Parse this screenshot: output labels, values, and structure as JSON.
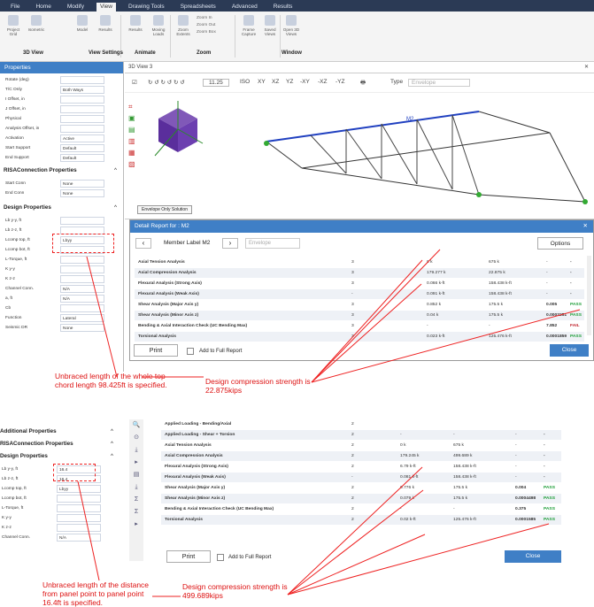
{
  "ribbon": {
    "tabs": [
      "File",
      "Home",
      "Modify",
      "View",
      "Drawing Tools",
      "Spreadsheets",
      "Advanced",
      "Results"
    ],
    "buttons": [
      "Project Grid",
      "Isometric",
      "Model",
      "Results",
      "Results",
      "Moving Loads",
      "Zoom Extents",
      "Zoom In",
      "Zoom Out",
      "Zoom Box",
      "Frame Capture",
      "Saved Views",
      "Open 3D Views"
    ],
    "groups": [
      "3D View",
      "View Settings",
      "Animate",
      "Zoom",
      "Window"
    ]
  },
  "props": {
    "title": "Properties",
    "top_rows": [
      {
        "label": "Rotate (deg)",
        "value": ""
      },
      {
        "label": "T/C Only",
        "value": "Both Ways"
      },
      {
        "label": "I Offset, in",
        "value": ""
      },
      {
        "label": "J Offset, in",
        "value": ""
      },
      {
        "label": "Physical",
        "value": ""
      },
      {
        "label": "Analysis Offset, in",
        "value": ""
      },
      {
        "label": "Activation",
        "value": "Active"
      },
      {
        "label": "Start Support",
        "value": "Default"
      },
      {
        "label": "End Support",
        "value": "Default"
      }
    ],
    "risa_title": "RISAConnection Properties",
    "risa_rows": [
      {
        "label": "Start Conn",
        "value": "None"
      },
      {
        "label": "End Conn",
        "value": "None"
      }
    ],
    "design_title": "Design Properties",
    "design_rows": [
      {
        "label": "Lb y-y, ft",
        "value": ""
      },
      {
        "label": "Lb z-z, ft",
        "value": ""
      },
      {
        "label": "Lcomp top, ft",
        "value": "Lbyy"
      },
      {
        "label": "Lcomp bot, ft",
        "value": ""
      },
      {
        "label": "L-Torque, ft",
        "value": ""
      },
      {
        "label": "K y-y",
        "value": ""
      },
      {
        "label": "K z-z",
        "value": ""
      },
      {
        "label": "Channel Conn.",
        "value": "N/A"
      },
      {
        "label": "a, ft",
        "value": "N/A"
      },
      {
        "label": "Cb",
        "value": ""
      },
      {
        "label": "Function",
        "value": "Lateral"
      },
      {
        "label": "Seismic DR",
        "value": "None"
      }
    ]
  },
  "view": {
    "title": "3D View 3",
    "toolbar": [
      "11.25",
      "ISO",
      "XY",
      "XZ",
      "YZ",
      "-XY",
      "-XZ",
      "-YZ",
      "Type",
      "Envelope"
    ],
    "envelope_label": "Envelope Only Solution",
    "m2_label": "M2"
  },
  "report": {
    "title": "Detail Report for : M2",
    "member_label": "Member Label M2",
    "dropdown": "Envelope",
    "options": "Options",
    "rows": [
      {
        "name": "Axial Tension Analysis",
        "lc": "3",
        "v1": "0 k",
        "v2": "675 k",
        "uc": "-",
        "s": "-"
      },
      {
        "name": "Axial Compression Analysis",
        "lc": "3",
        "v1": "179.277 k",
        "v2": "22.875 k",
        "uc": "-",
        "s": "-"
      },
      {
        "name": "Flexural Analysis (Strong Axis)",
        "lc": "3",
        "v1": "0.066 k-ft",
        "v2": "158.438 k-ft",
        "uc": "-",
        "s": "-"
      },
      {
        "name": "Flexural Analysis (Weak Axis)",
        "lc": "-",
        "v1": "0.091 k-ft",
        "v2": "158.438 k-ft",
        "uc": "-",
        "s": "-"
      },
      {
        "name": "Shear Analysis (Major Axis y)",
        "lc": "3",
        "v1": "0.852 k",
        "v2": "175.5 k",
        "uc": "0.005",
        "s": "PASS"
      },
      {
        "name": "Shear Analysis (Minor Axis z)",
        "lc": "3",
        "v1": "0.04 k",
        "v2": "175.5 k",
        "uc": "0.0002251",
        "s": "PASS"
      },
      {
        "name": "Bending & Axial Interaction Check (UC Bending Max)",
        "lc": "3",
        "v1": "-",
        "v2": "-",
        "uc": "7.852",
        "s": "FAIL"
      },
      {
        "name": "Torsional Analysis",
        "lc": "3",
        "v1": "0.023 k-ft",
        "v2": "125.476 k-ft",
        "uc": "0.0001859",
        "s": "PASS"
      }
    ],
    "print": "Print",
    "add": "Add to Full Report",
    "close": "Close"
  },
  "annotations": {
    "a1": "Unbraced length of the whole top chord length 98.425ft is specified.",
    "a2": "Design compression strength is 22.875kips",
    "a3": "Unbraced length of the distance from panel point to panel point 16.4ft is specified.",
    "a4": "Design compression strength is 499.689kips"
  },
  "bottom": {
    "props": [
      {
        "label": "Additional Properties",
        "kind": "sec"
      },
      {
        "label": "RISAConnection Properties",
        "kind": "sec"
      },
      {
        "label": "Design Properties",
        "kind": "sec"
      },
      {
        "label": "Lb y-y, ft",
        "value": "16.4"
      },
      {
        "label": "Lb z-z, ft",
        "value": "16.4"
      },
      {
        "label": "Lcomp top, ft",
        "value": "Lbyy"
      },
      {
        "label": "Lcomp bot, ft",
        "value": ""
      },
      {
        "label": "L-Torque, ft",
        "value": ""
      },
      {
        "label": "K y-y",
        "value": ""
      },
      {
        "label": "K z-z",
        "value": ""
      },
      {
        "label": "Channel Conn.",
        "value": "N/A"
      }
    ],
    "rows": [
      {
        "name": "Applied Loading - Bending/Axial",
        "lc": "2",
        "v1": "",
        "v2": "",
        "uc": "",
        "s": ""
      },
      {
        "name": "Applied Loading - Shear + Torsion",
        "lc": "2",
        "v1": "-",
        "v2": "-",
        "uc": "-",
        "s": "-"
      },
      {
        "name": "Axial Tension Analysis",
        "lc": "2",
        "v1": "0 k",
        "v2": "675 k",
        "uc": "-",
        "s": "-"
      },
      {
        "name": "Axial Compression Analysis",
        "lc": "2",
        "v1": "179.245 k",
        "v2": "499.689 k",
        "uc": "-",
        "s": "-"
      },
      {
        "name": "Flexural Analysis (Strong Axis)",
        "lc": "2",
        "v1": "6.79 k-ft",
        "v2": "158.438 k-ft",
        "uc": "-",
        "s": "-"
      },
      {
        "name": "Flexural Analysis (Weak Axis)",
        "lc": "-",
        "v1": "0.081 k-ft",
        "v2": "158.438 k-ft",
        "uc": "-",
        "s": "-"
      },
      {
        "name": "Shear Analysis (Major Axis y)",
        "lc": "2",
        "v1": "0.776 k",
        "v2": "175.5 k",
        "uc": "0.004",
        "s": "PASS"
      },
      {
        "name": "Shear Analysis (Minor Axis z)",
        "lc": "2",
        "v1": "0.079 k",
        "v2": "175.5 k",
        "uc": "0.0004498",
        "s": "PASS"
      },
      {
        "name": "Bending & Axial Interaction Check (UC Bending Max)",
        "lc": "2",
        "v1": "-",
        "v2": "-",
        "uc": "0.375",
        "s": "PASS"
      },
      {
        "name": "Torsional Analysis",
        "lc": "2",
        "v1": "0.02 k-ft",
        "v2": "125.476 k-ft",
        "uc": "0.0001585",
        "s": "PASS"
      }
    ],
    "print": "Print",
    "add": "Add to Full Report",
    "close": "Close"
  },
  "colors": {
    "accent": "#3f7fc6",
    "pass": "#1e9e38",
    "fail": "#c0202a",
    "annot": "#dd1111"
  }
}
